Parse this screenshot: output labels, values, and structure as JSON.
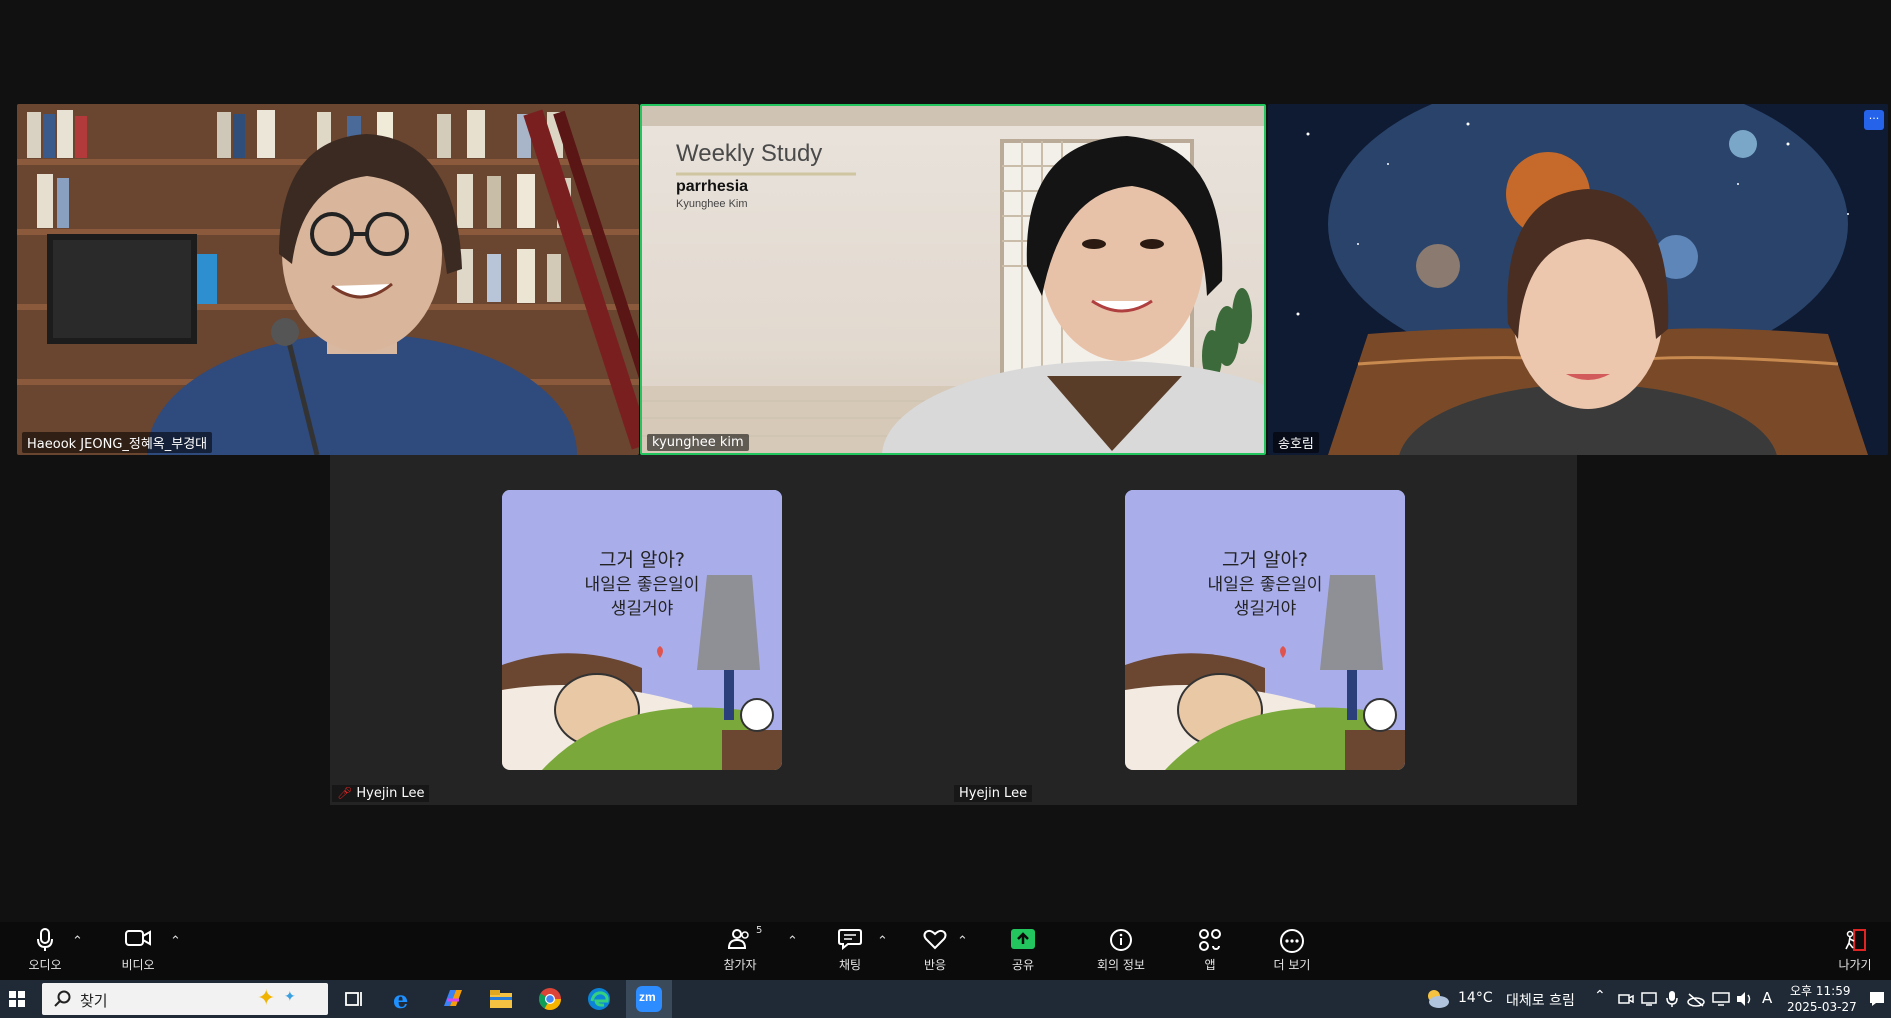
{
  "participants": {
    "tile1_name": "Haeook JEONG_정혜옥_부경대",
    "tile2_name": "kyunghee kim",
    "tile3_name": "송호림",
    "hyejin1_name": "Hyejin Lee",
    "hyejin2_name": "Hyejin Lee"
  },
  "slide": {
    "title": "Weekly Study",
    "subtitle": "parrhesia",
    "author": "Kyunghee Kim"
  },
  "avatar_art": {
    "line1": "그거 알아?",
    "line2": "내일은 좋은일이",
    "line3": "생길거야"
  },
  "toolbar": {
    "audio": "오디오",
    "video": "비디오",
    "participants": "참가자",
    "participants_count": "5",
    "chat": "채팅",
    "reactions": "반응",
    "share": "공유",
    "meeting_info": "회의 정보",
    "apps": "앱",
    "more": "더 보기",
    "leave": "나가기",
    "more_dots": "···"
  },
  "taskbar": {
    "search_placeholder": "찾기",
    "weather_temp": "14°C",
    "weather_text": "대체로 흐림",
    "time": "오후 11:59",
    "date": "2025-03-27",
    "ime": "A"
  },
  "colors": {
    "active_speaker_border": "#22c55e",
    "share_button": "#22c55e",
    "leave_red": "#e02424",
    "muted_red": "#e02424",
    "more_badge": "#2563eb"
  }
}
